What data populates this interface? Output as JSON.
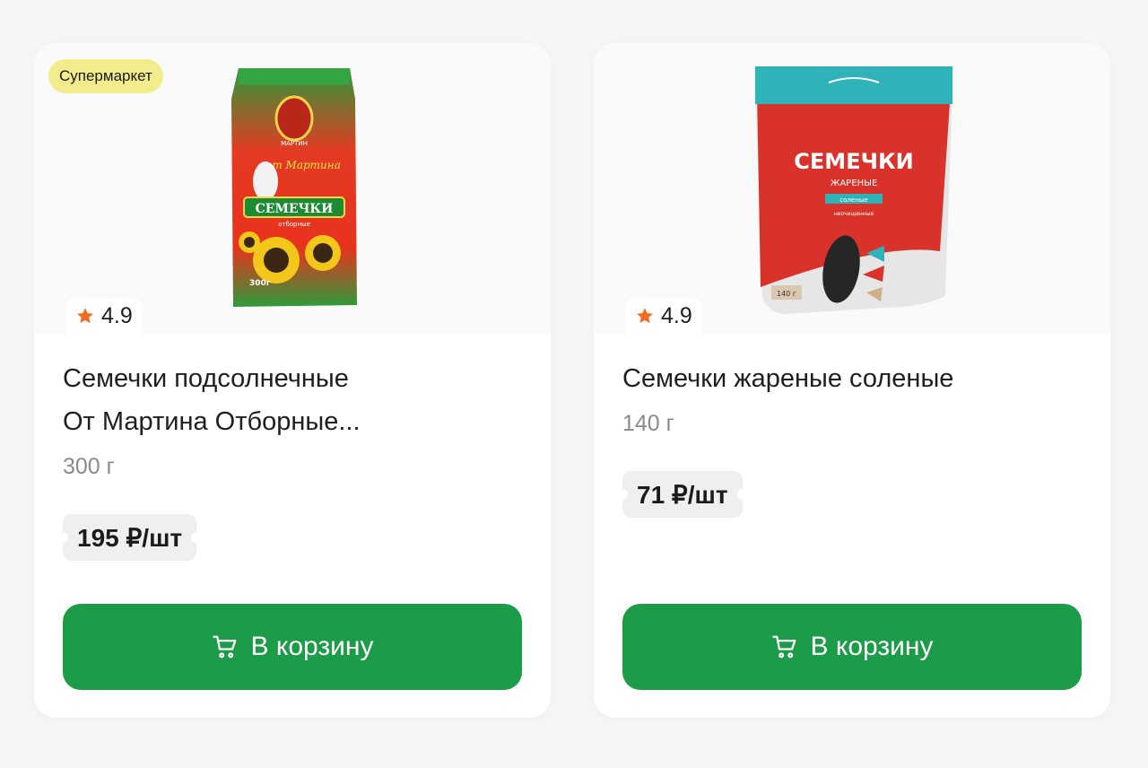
{
  "products": [
    {
      "badge": "Супермаркет",
      "rating": "4.9",
      "title_line1": "Семечки подсолнечные",
      "title_line2": "От Мартина Отборные...",
      "weight": "300 г",
      "price": "195 ₽/шт",
      "cart_label": "В корзину",
      "package_text": {
        "brand": "МАРТИН",
        "script": "от Мартина",
        "name": "СЕМЕЧКИ",
        "sub": "отборные",
        "weight": "300г"
      }
    },
    {
      "rating": "4.9",
      "title": "Семечки жареные соленые",
      "weight": "140 г",
      "price": "71 ₽/шт",
      "cart_label": "В корзину",
      "package_text": {
        "name": "СЕМЕЧКИ",
        "sub1": "ЖАРЕНЫЕ",
        "sub2": "соленые",
        "sub3": "неочищенные",
        "weight": "140 г"
      }
    }
  ],
  "colors": {
    "badge_bg": "#f2ec8c",
    "cart_button": "#1c9b48",
    "star": "#f36b21",
    "price_bg": "#efeff2"
  },
  "icons": [
    "star-icon",
    "cart-icon"
  ]
}
